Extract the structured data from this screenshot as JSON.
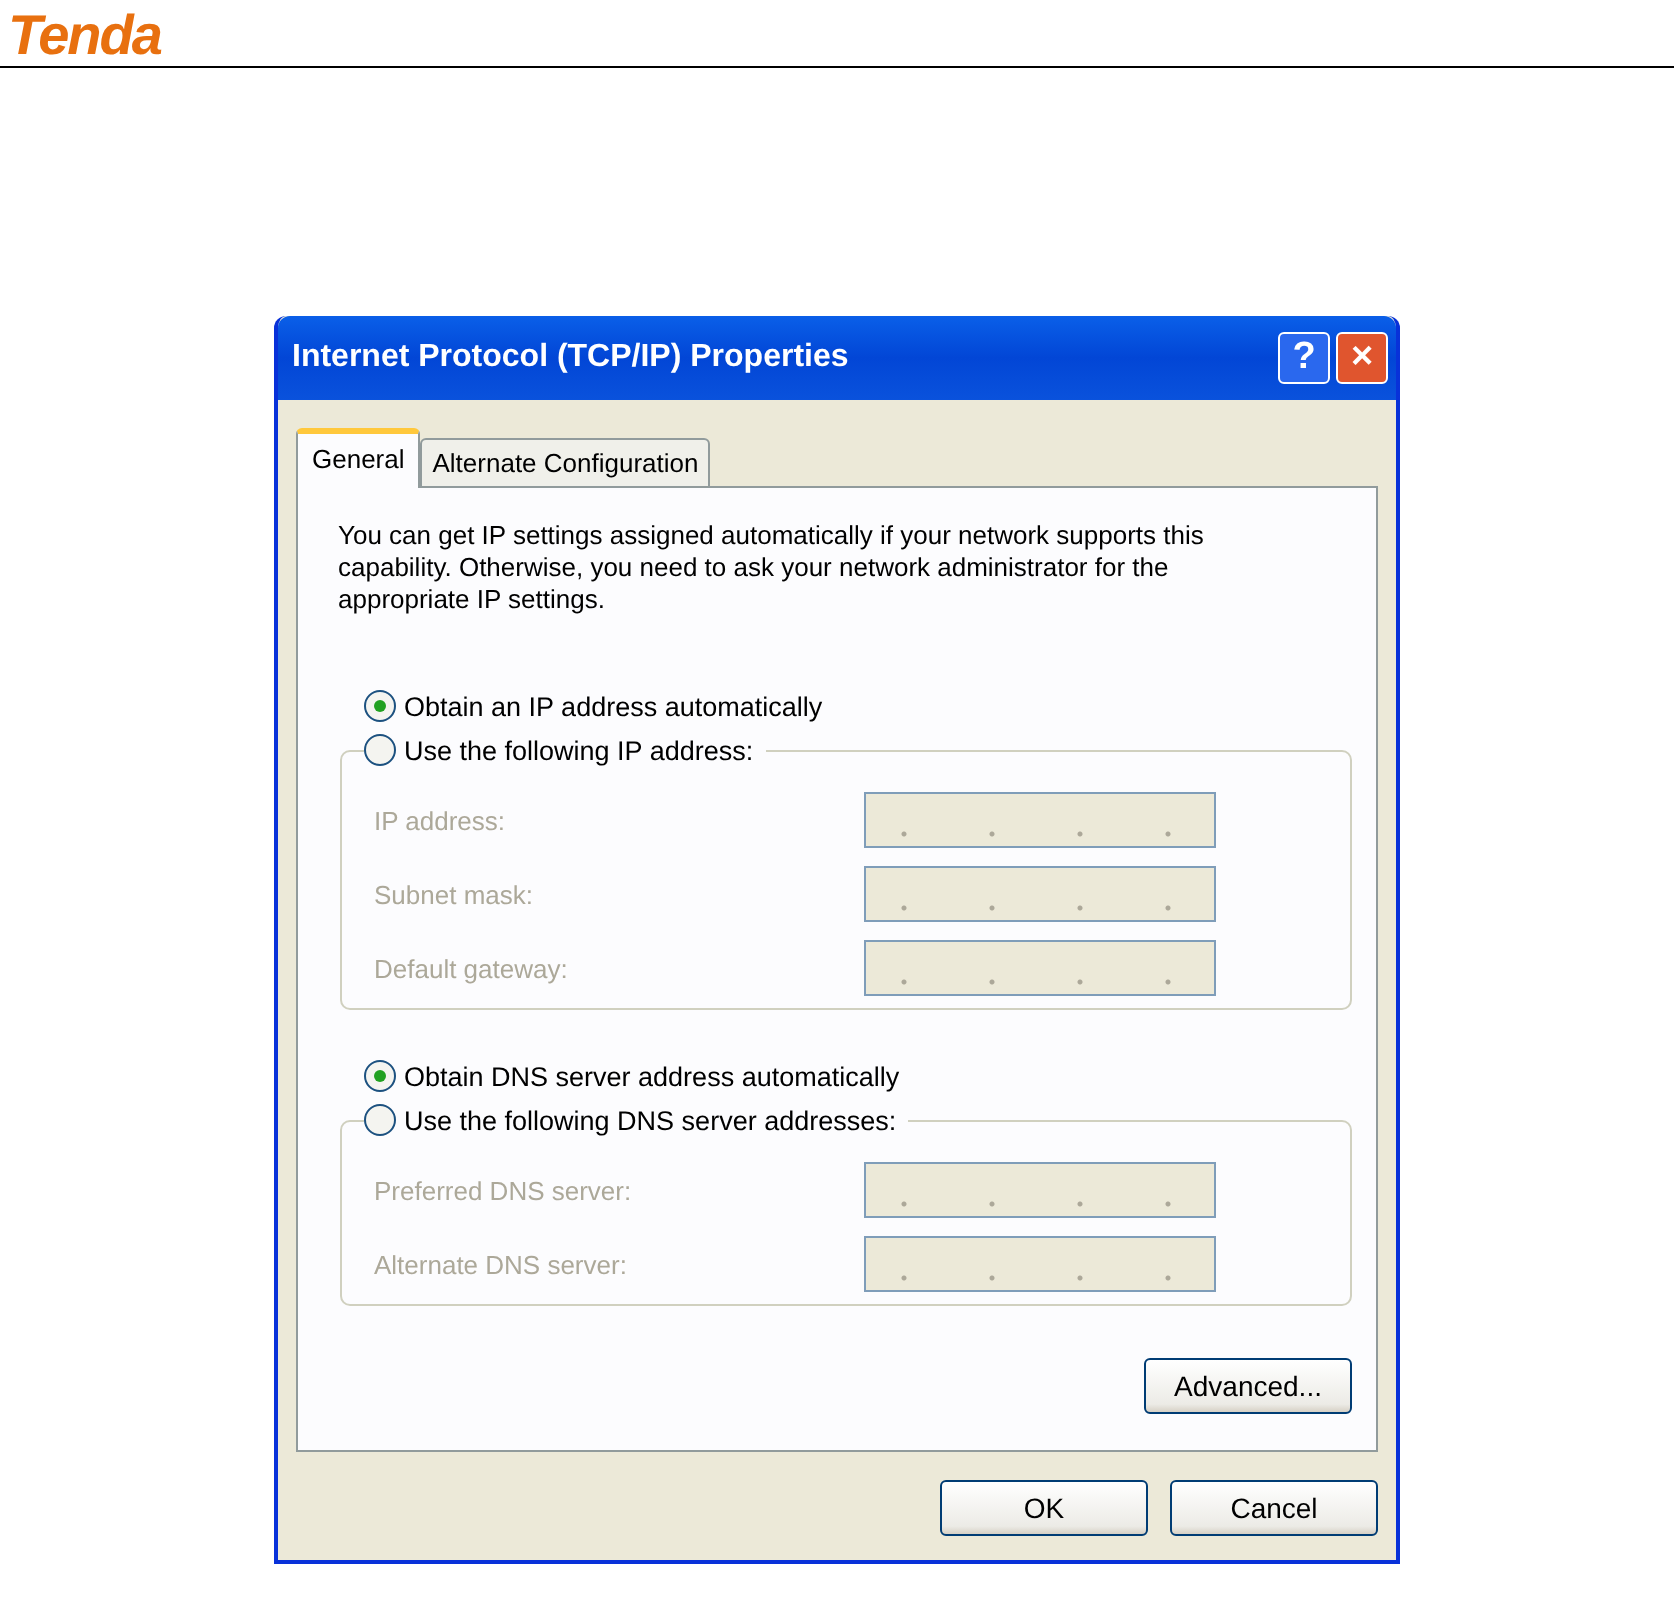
{
  "header": {
    "logo": "Tenda"
  },
  "window": {
    "title": "Internet Protocol (TCP/IP) Properties",
    "help": "?",
    "close": "×"
  },
  "tabs": [
    {
      "label": "General",
      "selected": true
    },
    {
      "label": "Alternate Configuration",
      "selected": false
    }
  ],
  "description": "You can get IP settings assigned automatically if your network supports this capability. Otherwise, you need to ask your network administrator for the appropriate IP settings.",
  "sections": [
    {
      "auto": {
        "label": "Obtain an IP address automatically",
        "selected": true
      },
      "manual": {
        "label": "Use the following IP address:",
        "selected": false
      },
      "fields": [
        {
          "label": "IP address:",
          "disabled": true
        },
        {
          "label": "Subnet mask:",
          "disabled": true
        },
        {
          "label": "Default gateway:",
          "disabled": true
        }
      ]
    },
    {
      "auto": {
        "label": "Obtain DNS server address automatically",
        "selected": true
      },
      "manual": {
        "label": "Use the following DNS server addresses:",
        "selected": false
      },
      "fields": [
        {
          "label": "Preferred DNS server:",
          "disabled": true
        },
        {
          "label": "Alternate DNS server:",
          "disabled": true
        }
      ]
    }
  ],
  "advanced_button": "Advanced...",
  "buttons": [
    "OK",
    "Cancel"
  ]
}
